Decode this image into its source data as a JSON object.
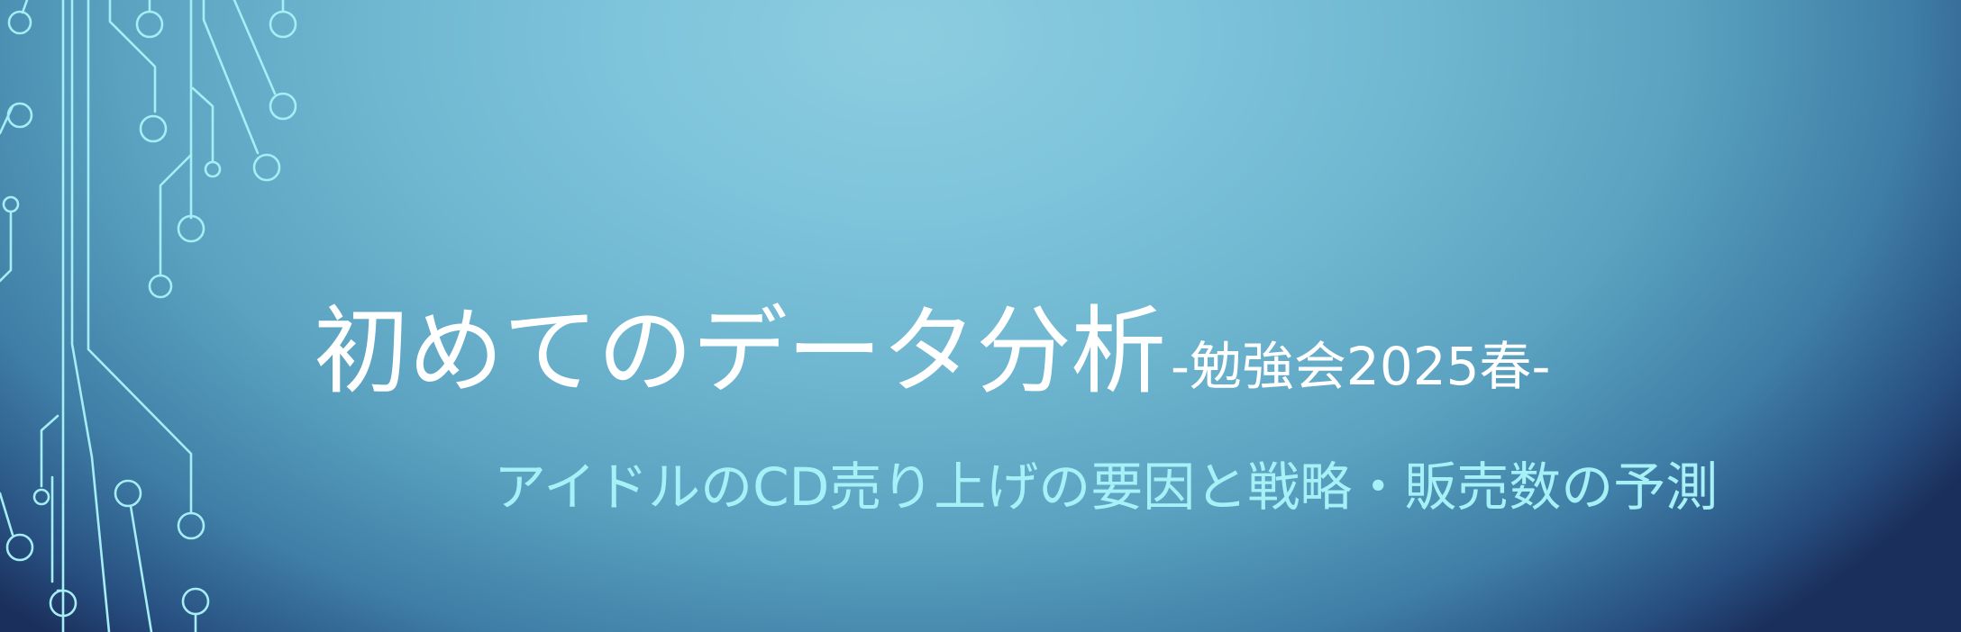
{
  "slide": {
    "main_title": "初めてのデータ分析",
    "title_suffix": "-勉強会2025春-",
    "subtitle": "アイドルのCD売り上げの要因と戦略・販売数の予測"
  },
  "colors": {
    "title": "#ffffff",
    "subtitle": "#a6f1f7",
    "circuit": "#a6eef5",
    "background_light": "#8dcde0",
    "background_dark": "#1b2f5c"
  }
}
